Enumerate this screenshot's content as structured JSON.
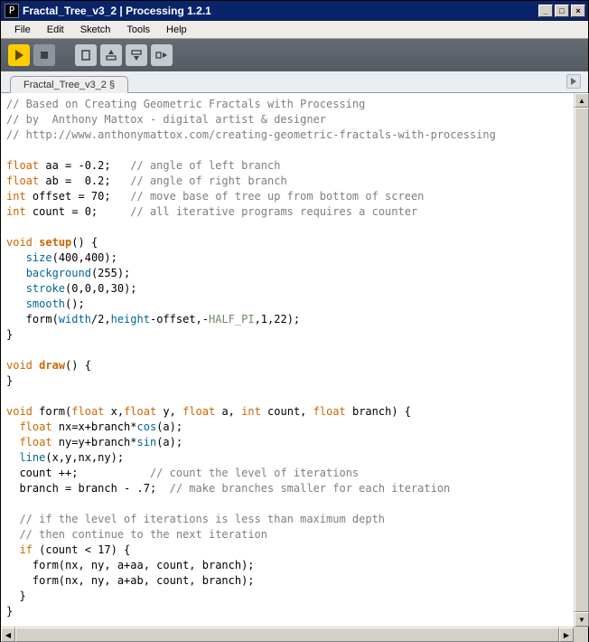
{
  "window": {
    "title": "Fractal_Tree_v3_2 | Processing 1.2.1",
    "app_icon_letter": "P"
  },
  "menu": {
    "items": [
      "File",
      "Edit",
      "Sketch",
      "Tools",
      "Help"
    ]
  },
  "toolbar": {
    "run_tooltip": "Run",
    "stop_tooltip": "Stop",
    "new_tooltip": "New",
    "open_tooltip": "Open",
    "save_tooltip": "Save",
    "export_tooltip": "Export"
  },
  "tabs": {
    "current": "Fractal_Tree_v3_2 §"
  },
  "code": {
    "lines": [
      [
        [
          "cmt",
          "// Based on Creating Geometric Fractals with Processing"
        ]
      ],
      [
        [
          "cmt",
          "// by  Anthony Mattox - digital artist & designer"
        ]
      ],
      [
        [
          "cmt",
          "// http://www.anthonymattox.com/creating-geometric-fractals-with-processing"
        ]
      ],
      [
        [
          "",
          "  "
        ]
      ],
      [
        [
          "kw",
          "float"
        ],
        [
          "",
          " aa = -0.2;   "
        ],
        [
          "cmt",
          "// angle of left branch"
        ]
      ],
      [
        [
          "kw",
          "float"
        ],
        [
          "",
          " ab =  0.2;   "
        ],
        [
          "cmt",
          "// angle of right branch"
        ]
      ],
      [
        [
          "kw",
          "int"
        ],
        [
          "",
          " offset = 70;   "
        ],
        [
          "cmt",
          "// move base of tree up from bottom of screen"
        ]
      ],
      [
        [
          "kw",
          "int"
        ],
        [
          "",
          " count = 0;     "
        ],
        [
          "cmt",
          "// all iterative programs requires a counter"
        ]
      ],
      [
        [
          "",
          "  "
        ]
      ],
      [
        [
          "kw",
          "void"
        ],
        [
          "",
          " "
        ],
        [
          "kwb",
          "setup"
        ],
        [
          "",
          "() {"
        ]
      ],
      [
        [
          "",
          "   "
        ],
        [
          "fn",
          "size"
        ],
        [
          "",
          "(400,400);"
        ]
      ],
      [
        [
          "",
          "   "
        ],
        [
          "fn",
          "background"
        ],
        [
          "",
          "(255);"
        ]
      ],
      [
        [
          "",
          "   "
        ],
        [
          "fn",
          "stroke"
        ],
        [
          "",
          "(0,0,0,30);"
        ]
      ],
      [
        [
          "",
          "   "
        ],
        [
          "fn",
          "smooth"
        ],
        [
          "",
          "();"
        ]
      ],
      [
        [
          "",
          "   form("
        ],
        [
          "fn",
          "width"
        ],
        [
          "",
          "/2,"
        ],
        [
          "fn",
          "height"
        ],
        [
          "",
          "-offset,-"
        ],
        [
          "const",
          "HALF_PI"
        ],
        [
          "",
          ",1,22);"
        ]
      ],
      [
        [
          "",
          "}"
        ]
      ],
      [
        [
          "",
          "  "
        ]
      ],
      [
        [
          "kw",
          "void"
        ],
        [
          "",
          " "
        ],
        [
          "kwb",
          "draw"
        ],
        [
          "",
          "() {"
        ]
      ],
      [
        [
          "",
          "}"
        ]
      ],
      [
        [
          "",
          "  "
        ]
      ],
      [
        [
          "kw",
          "void"
        ],
        [
          "",
          " form("
        ],
        [
          "kw",
          "float"
        ],
        [
          "",
          " x,"
        ],
        [
          "kw",
          "float"
        ],
        [
          "",
          " y, "
        ],
        [
          "kw",
          "float"
        ],
        [
          "",
          " a, "
        ],
        [
          "kw",
          "int"
        ],
        [
          "",
          " count, "
        ],
        [
          "kw",
          "float"
        ],
        [
          "",
          " branch) {"
        ]
      ],
      [
        [
          "",
          "  "
        ],
        [
          "kw",
          "float"
        ],
        [
          "",
          " nx=x+branch*"
        ],
        [
          "fn",
          "cos"
        ],
        [
          "",
          "(a);"
        ]
      ],
      [
        [
          "",
          "  "
        ],
        [
          "kw",
          "float"
        ],
        [
          "",
          " ny=y+branch*"
        ],
        [
          "fn",
          "sin"
        ],
        [
          "",
          "(a);"
        ]
      ],
      [
        [
          "",
          "  "
        ],
        [
          "fn",
          "line"
        ],
        [
          "",
          "(x,y,nx,ny);"
        ]
      ],
      [
        [
          "",
          "  count ++;           "
        ],
        [
          "cmt",
          "// count the level of iterations"
        ]
      ],
      [
        [
          "",
          "  branch = branch - .7;  "
        ],
        [
          "cmt",
          "// make branches smaller for each iteration"
        ]
      ],
      [
        [
          "",
          "  "
        ]
      ],
      [
        [
          "",
          "  "
        ],
        [
          "cmt",
          "// if the level of iterations is less than maximum depth"
        ]
      ],
      [
        [
          "",
          "  "
        ],
        [
          "cmt",
          "// then continue to the next iteration"
        ]
      ],
      [
        [
          "",
          "  "
        ],
        [
          "kw",
          "if"
        ],
        [
          "",
          " (count < 17) {"
        ]
      ],
      [
        [
          "",
          "    form(nx, ny, a+aa, count, branch);"
        ]
      ],
      [
        [
          "",
          "    form(nx, ny, a+ab, count, branch);"
        ]
      ],
      [
        [
          "",
          "  }"
        ]
      ],
      [
        [
          "",
          "}"
        ]
      ]
    ]
  }
}
